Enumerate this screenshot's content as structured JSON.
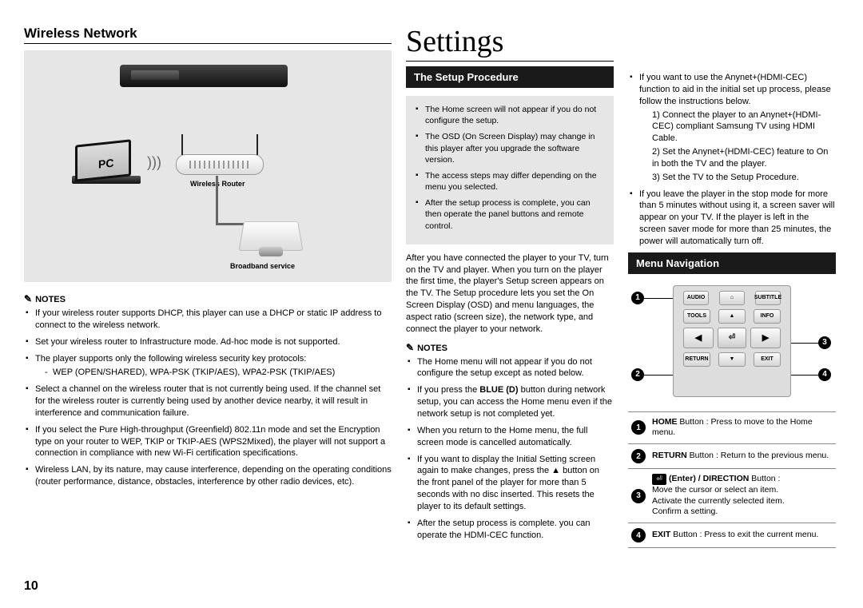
{
  "page_number": "10",
  "chapter_title": "Settings",
  "col1": {
    "section_title": "Wireless Network",
    "diagram": {
      "pc_label": "PC",
      "router_label": "Wireless Router",
      "modem_label": "Broadband service"
    },
    "notes_label": "NOTES",
    "notes": [
      "If your wireless router supports DHCP, this player can use a DHCP or static IP address to connect to the wireless network.",
      "Set your wireless router to Infrastructure mode. Ad-hoc mode is not supported.",
      "The player supports only the following wireless security key protocols:",
      "Select a channel on the wireless router that is not currently being used. If the channel set for the wireless router is currently being used by another device nearby, it will result in interference and communication failure.",
      "If you select the Pure High-throughput (Greenfield) 802.11n mode and set the Encryption type on your router to WEP, TKIP or TKIP-AES (WPS2Mixed), the player will not support a connection in compliance with new Wi-Fi certification specifications.",
      "Wireless LAN, by its nature, may cause interference, depending on the operating conditions (router performance, distance, obstacles, interference by other radio devices, etc)."
    ],
    "security_sub": [
      "WEP (OPEN/SHARED), WPA-PSK (TKIP/AES), WPA2-PSK (TKIP/AES)"
    ]
  },
  "col2": {
    "setup_heading": "The Setup Procedure",
    "gray_bullets": [
      "The Home screen will not appear if you do not configure the setup.",
      "The OSD (On Screen Display) may change in this player after you upgrade the software version.",
      "The access steps may differ depending on the menu you selected.",
      "After the setup process is complete, you can then operate the panel buttons and remote control."
    ],
    "after_paragraph": "After you have connected the player to your TV, turn on the TV and player. When you turn on the player the first time, the player's Setup screen appears on the TV. The Setup procedure lets you set the On Screen Display (OSD) and menu languages, the aspect ratio (screen size), the network type, and connect the player to your network.",
    "notes_label": "NOTES",
    "notes": [
      "The Home menu will not appear if you do not configure the setup except as noted below.",
      "If you press the BLUE (D) button during network setup, you can access the Home menu even if the network setup is not completed yet.",
      "When you return to the Home menu, the full screen mode is cancelled automatically.",
      "If you want to display the Initial Setting screen again to make changes, press the ▲ button on the front panel of the player for more than 5 seconds with no disc inserted. This resets the player to its default settings.",
      "After the setup process is complete. you can operate the HDMI-CEC function."
    ]
  },
  "col3": {
    "top_bullets": [
      "If you want to use the Anynet+(HDMI-CEC) function to aid in the initial set up process, please follow the instructions below."
    ],
    "anycec_steps": [
      "1) Connect the player to an Anynet+(HDMI-CEC) compliant Samsung TV using HDMI Cable.",
      "2) Set the Anynet+(HDMI-CEC) feature to On in both the TV and the player.",
      "3) Set the TV to the Setup Procedure."
    ],
    "leave_bullet": "If you leave the player in the stop mode for more than 5 minutes without using it, a screen saver will appear on your TV. If the player is left in the screen saver mode for more than 25 minutes, the power will automatically turn off.",
    "menu_nav_heading": "Menu Navigation",
    "remote_buttons": {
      "audio": "AUDIO",
      "home": "HOME",
      "subtitle": "SUBTITLE",
      "tools": "TOOLS",
      "info": "INFO",
      "return": "RETURN",
      "exit": "EXIT"
    },
    "table": [
      {
        "num": "1",
        "text_strong": "HOME",
        "text_rest": " Button : Press to move to the Home menu."
      },
      {
        "num": "2",
        "text_strong": "RETURN",
        "text_rest": " Button : Return to the previous menu."
      },
      {
        "num": "3",
        "text_strong": "(Enter) / DIRECTION",
        "text_rest": " Button :\nMove the cursor or select an item.\nActivate the currently selected item.\nConfirm a setting."
      },
      {
        "num": "4",
        "text_strong": "EXIT",
        "text_rest": " Button : Press to exit the current menu."
      }
    ]
  }
}
